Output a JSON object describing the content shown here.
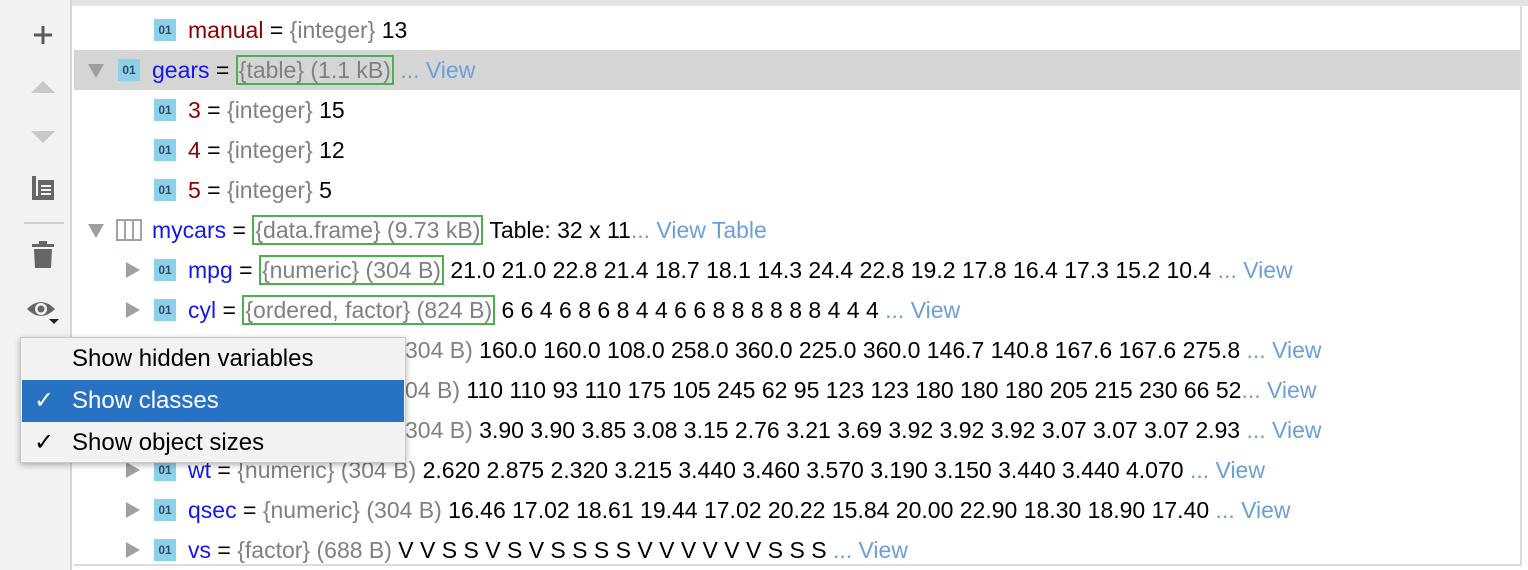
{
  "toolbar": {
    "buttons": [
      {
        "name": "add-icon",
        "glyph": "+"
      },
      {
        "name": "move-up-icon",
        "glyph": "up"
      },
      {
        "name": "move-down-icon",
        "glyph": "down"
      },
      {
        "name": "copy-icon",
        "glyph": "copy"
      },
      {
        "name": "delete-icon",
        "glyph": "trash"
      },
      {
        "name": "eye-icon",
        "glyph": "eye"
      }
    ]
  },
  "colors": {
    "selection": "#d5d5d5",
    "class_box": "#4cb050",
    "link": "#6b9fd8",
    "variable": "#1515f0",
    "element": "#8b0000",
    "menu_highlight": "#2872c4"
  },
  "tree": {
    "rows": [
      {
        "level": 1,
        "expander": "none",
        "icon": "01",
        "name": "manual",
        "kind": "el",
        "eq": " = ",
        "cls": "{integer}",
        "boxed": false,
        "values": " 13"
      },
      {
        "level": 0,
        "expander": "down",
        "icon": "01",
        "name": "gears",
        "kind": "var",
        "eq": " = ",
        "cls": "{table} (1.1 kB)",
        "boxed": true,
        "values": " ",
        "link": "... View",
        "selected": true
      },
      {
        "level": 1,
        "expander": "none",
        "icon": "01",
        "name": "3",
        "kind": "el",
        "eq": " = ",
        "cls": "{integer}",
        "values": " 15"
      },
      {
        "level": 1,
        "expander": "none",
        "icon": "01",
        "name": "4",
        "kind": "el",
        "eq": " = ",
        "cls": "{integer}",
        "values": " 12"
      },
      {
        "level": 1,
        "expander": "none",
        "icon": "01",
        "name": "5",
        "kind": "el",
        "eq": " = ",
        "cls": "{integer}",
        "values": " 5"
      },
      {
        "level": 0,
        "expander": "down",
        "icon": "table",
        "name": "mycars",
        "kind": "var",
        "eq": " = ",
        "cls": "{data.frame} (9.73 kB)",
        "boxed": true,
        "values": " Table: 32 x 11",
        "link": "... View Table"
      },
      {
        "level": 1,
        "expander": "right",
        "icon": "01",
        "name": "mpg",
        "kind": "var",
        "eq": " = ",
        "cls": "{numeric} (304 B)",
        "boxed": true,
        "values": " 21.0 21.0 22.8 21.4 18.7 18.1 14.3 24.4 22.8 19.2 17.8 16.4 17.3 15.2 10.4 ",
        "link": "... View"
      },
      {
        "level": 1,
        "expander": "right",
        "icon": "01",
        "name": "cyl",
        "kind": "var",
        "eq": " = ",
        "cls": "{ordered, factor} (824 B)",
        "boxed": true,
        "values": " 6 6 4 6 8 6 8 4 4 6 6 8 8 8 8 8 8 4 4 4 ",
        "link": "... View"
      },
      {
        "partial": true,
        "offset": 405,
        "cls": "304 B)",
        "values": " 160.0 160.0 108.0 258.0 360.0 225.0 360.0 146.7 140.8 167.6 167.6 275.8 ",
        "link": "... View"
      },
      {
        "partial": true,
        "offset": 405,
        "cls": "04 B)",
        "values": " 110 110  93 110 175 105 245  62  95 123 123 180 180 180 205 215 230  66  52",
        "link": "... View"
      },
      {
        "partial": true,
        "offset": 405,
        "cls": "304 B)",
        "values": " 3.90 3.90 3.85 3.08 3.15 2.76 3.21 3.69 3.92 3.92 3.92 3.07 3.07 3.07 2.93 ",
        "link": "... View"
      },
      {
        "level": 1,
        "expander": "right",
        "icon": "01",
        "name": "wt",
        "kind": "var",
        "eq": " = ",
        "cls": "{numeric} (304 B)",
        "values": " 2.620 2.875 2.320 3.215 3.440 3.460 3.570 3.190 3.150 3.440 3.440 4.070 ",
        "link": "... View"
      },
      {
        "level": 1,
        "expander": "right",
        "icon": "01",
        "name": "qsec",
        "kind": "var",
        "eq": " = ",
        "cls": "{numeric} (304 B)",
        "values": " 16.46 17.02 18.61 19.44 17.02 20.22 15.84 20.00 22.90 18.30 18.90 17.40 ",
        "link": "... View"
      },
      {
        "level": 1,
        "expander": "right",
        "icon": "01",
        "name": "vs",
        "kind": "var",
        "eq": " = ",
        "cls": "{factor} (688 B)",
        "values": " V V S S V S V S S S S V V V V V V S S S ",
        "link": "... View"
      }
    ]
  },
  "menu": {
    "items": [
      {
        "label": "Show hidden variables",
        "checked": false,
        "highlighted": false
      },
      {
        "label": "Show classes",
        "checked": true,
        "highlighted": true
      },
      {
        "label": "Show object sizes",
        "checked": true,
        "highlighted": false
      }
    ],
    "check_glyph": "✓"
  }
}
